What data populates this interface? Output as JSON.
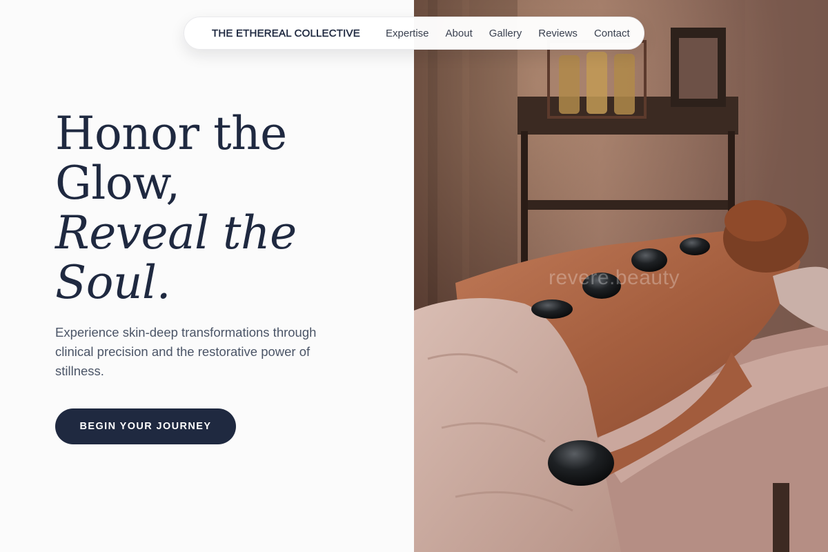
{
  "nav": {
    "brand": "THE ETHEREAL COLLECTIVE",
    "links": [
      "Expertise",
      "About",
      "Gallery",
      "Reviews",
      "Contact"
    ]
  },
  "hero": {
    "headline_line1": "Honor the",
    "headline_line2": "Glow,",
    "headline_italic_line1": "Reveal the",
    "headline_italic_line2": "Soul.",
    "subcopy": "Experience skin-deep transformations through clinical precision and the restorative power of stillness.",
    "cta_label": "BEGIN YOUR JOURNEY"
  },
  "image": {
    "watermark": "revere.beauty"
  },
  "colors": {
    "navy": "#1f2940",
    "body_text": "#4b5567",
    "background": "#fbfbfb"
  }
}
